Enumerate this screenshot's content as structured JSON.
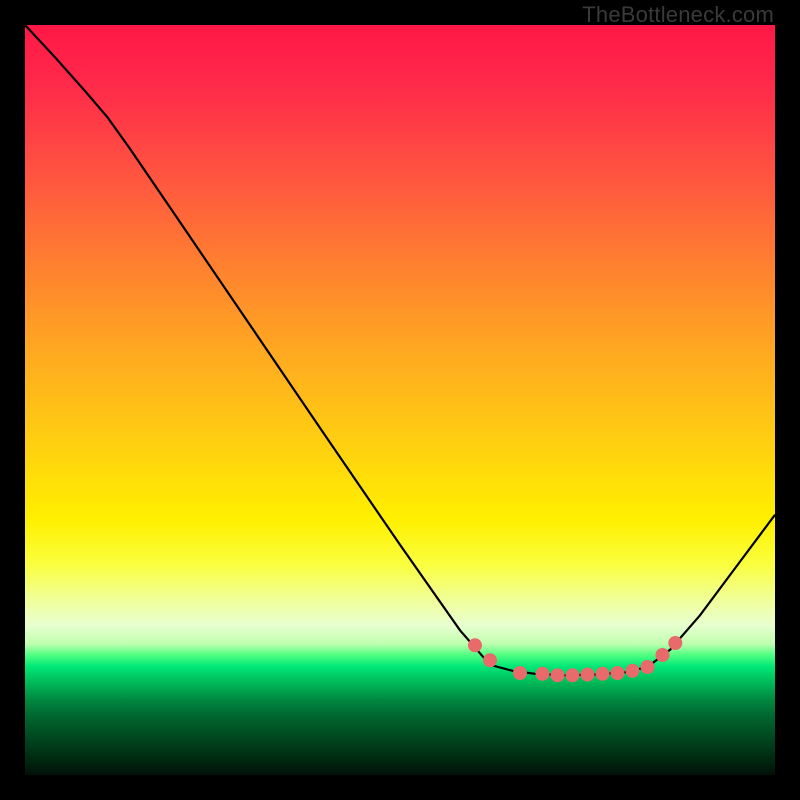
{
  "watermark": "TheBottleneck.com",
  "chart_data": {
    "type": "line",
    "title": "",
    "xlabel": "",
    "ylabel": "",
    "xlim": [
      0,
      100
    ],
    "ylim": [
      0,
      100
    ],
    "curve": {
      "name": "bottleneck-curve",
      "points": [
        {
          "x": 0.0,
          "y": 100.0
        },
        {
          "x": 4.0,
          "y": 95.7
        },
        {
          "x": 8.0,
          "y": 91.2
        },
        {
          "x": 11.0,
          "y": 87.7
        },
        {
          "x": 14.0,
          "y": 83.5
        },
        {
          "x": 20.0,
          "y": 74.7
        },
        {
          "x": 30.0,
          "y": 60.0
        },
        {
          "x": 40.0,
          "y": 45.3
        },
        {
          "x": 50.0,
          "y": 30.7
        },
        {
          "x": 58.0,
          "y": 19.3
        },
        {
          "x": 62.0,
          "y": 14.7
        },
        {
          "x": 65.0,
          "y": 13.9
        },
        {
          "x": 68.0,
          "y": 13.5
        },
        {
          "x": 72.0,
          "y": 13.3
        },
        {
          "x": 76.0,
          "y": 13.4
        },
        {
          "x": 80.0,
          "y": 13.7
        },
        {
          "x": 83.0,
          "y": 14.4
        },
        {
          "x": 86.0,
          "y": 16.7
        },
        {
          "x": 90.0,
          "y": 21.3
        },
        {
          "x": 95.0,
          "y": 28.0
        },
        {
          "x": 100.0,
          "y": 34.7
        }
      ]
    },
    "dots": {
      "name": "marker-dots",
      "color": "#e86a6a",
      "points": [
        {
          "x": 60.0,
          "y": 17.3
        },
        {
          "x": 62.0,
          "y": 15.3
        },
        {
          "x": 66.0,
          "y": 13.6
        },
        {
          "x": 69.0,
          "y": 13.5
        },
        {
          "x": 71.0,
          "y": 13.3
        },
        {
          "x": 73.0,
          "y": 13.3
        },
        {
          "x": 75.0,
          "y": 13.4
        },
        {
          "x": 77.0,
          "y": 13.5
        },
        {
          "x": 79.0,
          "y": 13.6
        },
        {
          "x": 81.0,
          "y": 13.9
        },
        {
          "x": 83.0,
          "y": 14.4
        },
        {
          "x": 85.0,
          "y": 16.0
        },
        {
          "x": 86.7,
          "y": 17.6
        }
      ]
    }
  }
}
